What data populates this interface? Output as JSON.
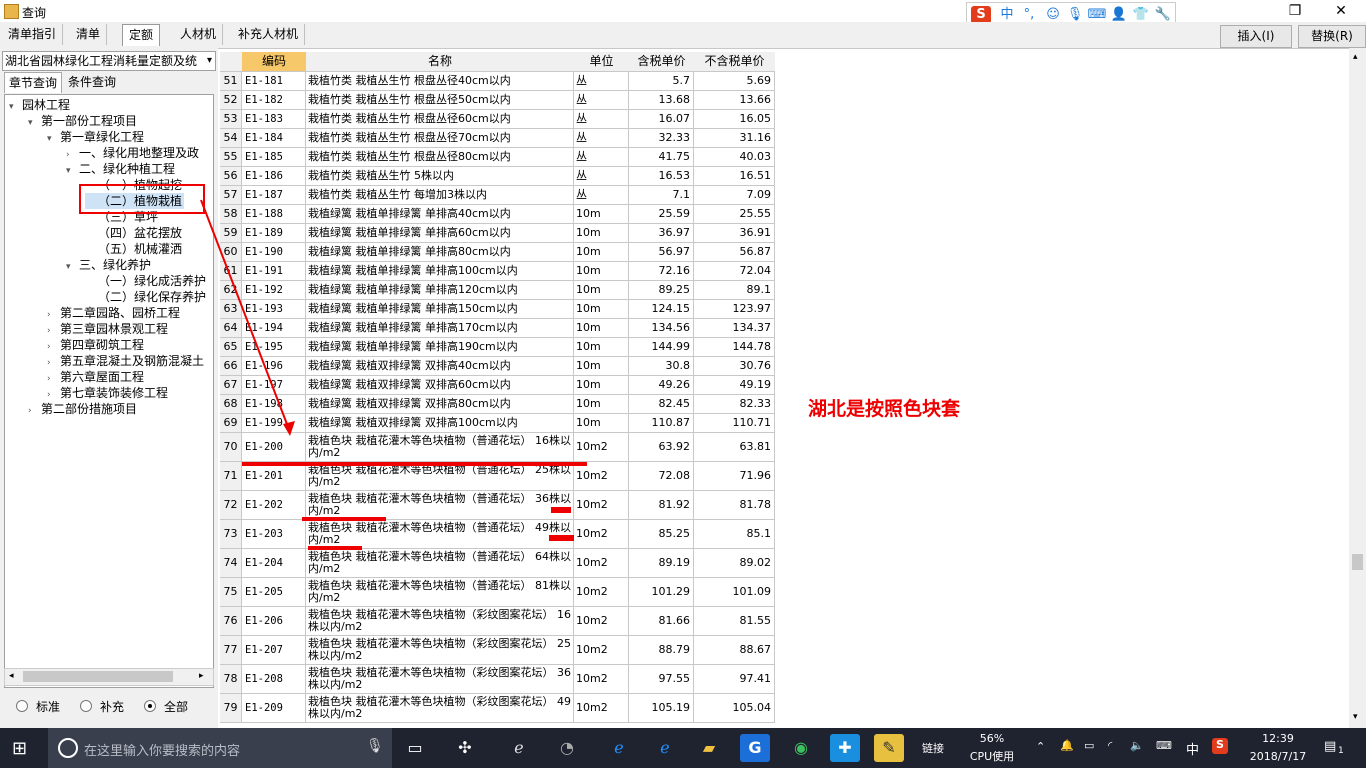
{
  "window": {
    "title": "查询"
  },
  "ime": {
    "brand": "S",
    "mode": "中",
    "punct": "°,"
  },
  "tabs": [
    "清单指引",
    "清单",
    "定额",
    "人材机",
    "补充人材机"
  ],
  "actions": {
    "insert": "插入(I)",
    "replace": "替换(R)"
  },
  "left": {
    "library": "湖北省园林绿化工程消耗量定额及统",
    "subtabs": [
      "章节查询",
      "条件查询"
    ],
    "tree": [
      {
        "label": "园林工程",
        "lvl": 0,
        "tog": "v"
      },
      {
        "label": "第一部份工程项目",
        "lvl": 1,
        "tog": "v"
      },
      {
        "label": "第一章绿化工程",
        "lvl": 2,
        "tog": "v"
      },
      {
        "label": "一、绿化用地整理及政",
        "lvl": 3,
        "tog": ">"
      },
      {
        "label": "二、绿化种植工程",
        "lvl": 3,
        "tog": "v"
      },
      {
        "label": "（一）植物起挖",
        "lvl": 4,
        "tog": ""
      },
      {
        "label": "（二）植物栽植",
        "lvl": 4,
        "tog": "",
        "selected": true
      },
      {
        "label": "（三）草坪",
        "lvl": 4,
        "tog": ""
      },
      {
        "label": "（四）盆花摆放",
        "lvl": 4,
        "tog": ""
      },
      {
        "label": "（五）机械灌洒",
        "lvl": 4,
        "tog": ""
      },
      {
        "label": "三、绿化养护",
        "lvl": 3,
        "tog": "v"
      },
      {
        "label": "（一）绿化成活养护",
        "lvl": 4,
        "tog": ""
      },
      {
        "label": "（二）绿化保存养护",
        "lvl": 4,
        "tog": ""
      },
      {
        "label": "第二章园路、园桥工程",
        "lvl": 2,
        "tog": ">"
      },
      {
        "label": "第三章园林景观工程",
        "lvl": 2,
        "tog": ">"
      },
      {
        "label": "第四章砌筑工程",
        "lvl": 2,
        "tog": ">"
      },
      {
        "label": "第五章混凝土及钢筋混凝土",
        "lvl": 2,
        "tog": ">"
      },
      {
        "label": "第六章屋面工程",
        "lvl": 2,
        "tog": ">"
      },
      {
        "label": "第七章装饰装修工程",
        "lvl": 2,
        "tog": ">"
      },
      {
        "label": "第二部份措施项目",
        "lvl": 1,
        "tog": ">"
      }
    ],
    "radios": [
      {
        "label": "标准",
        "checked": false
      },
      {
        "label": "补充",
        "checked": false
      },
      {
        "label": "全部",
        "checked": true
      }
    ]
  },
  "grid": {
    "headers": [
      "编码",
      "名称",
      "单位",
      "含税单价",
      "不含税单价"
    ],
    "rows": [
      {
        "n": "51",
        "code": "E1-181",
        "name": "栽植竹类 栽植丛生竹 根盘丛径40cm以内",
        "unit": "丛",
        "p1": "5.7",
        "p2": "5.69"
      },
      {
        "n": "52",
        "code": "E1-182",
        "name": "栽植竹类 栽植丛生竹 根盘丛径50cm以内",
        "unit": "丛",
        "p1": "13.68",
        "p2": "13.66"
      },
      {
        "n": "53",
        "code": "E1-183",
        "name": "栽植竹类 栽植丛生竹 根盘丛径60cm以内",
        "unit": "丛",
        "p1": "16.07",
        "p2": "16.05"
      },
      {
        "n": "54",
        "code": "E1-184",
        "name": "栽植竹类 栽植丛生竹 根盘丛径70cm以内",
        "unit": "丛",
        "p1": "32.33",
        "p2": "31.16"
      },
      {
        "n": "55",
        "code": "E1-185",
        "name": "栽植竹类 栽植丛生竹 根盘丛径80cm以内",
        "unit": "丛",
        "p1": "41.75",
        "p2": "40.03"
      },
      {
        "n": "56",
        "code": "E1-186",
        "name": "栽植竹类 栽植丛生竹 5株以内",
        "unit": "丛",
        "p1": "16.53",
        "p2": "16.51"
      },
      {
        "n": "57",
        "code": "E1-187",
        "name": "栽植竹类 栽植丛生竹 每增加3株以内",
        "unit": "丛",
        "p1": "7.1",
        "p2": "7.09"
      },
      {
        "n": "58",
        "code": "E1-188",
        "name": "栽植绿篱 栽植单排绿篱 单排高40cm以内",
        "unit": "10m",
        "p1": "25.59",
        "p2": "25.55"
      },
      {
        "n": "59",
        "code": "E1-189",
        "name": "栽植绿篱 栽植单排绿篱 单排高60cm以内",
        "unit": "10m",
        "p1": "36.97",
        "p2": "36.91"
      },
      {
        "n": "60",
        "code": "E1-190",
        "name": "栽植绿篱 栽植单排绿篱 单排高80cm以内",
        "unit": "10m",
        "p1": "56.97",
        "p2": "56.87"
      },
      {
        "n": "61",
        "code": "E1-191",
        "name": "栽植绿篱 栽植单排绿篱 单排高100cm以内",
        "unit": "10m",
        "p1": "72.16",
        "p2": "72.04"
      },
      {
        "n": "62",
        "code": "E1-192",
        "name": "栽植绿篱 栽植单排绿篱 单排高120cm以内",
        "unit": "10m",
        "p1": "89.25",
        "p2": "89.1"
      },
      {
        "n": "63",
        "code": "E1-193",
        "name": "栽植绿篱 栽植单排绿篱 单排高150cm以内",
        "unit": "10m",
        "p1": "124.15",
        "p2": "123.97"
      },
      {
        "n": "64",
        "code": "E1-194",
        "name": "栽植绿篱 栽植单排绿篱 单排高170cm以内",
        "unit": "10m",
        "p1": "134.56",
        "p2": "134.37"
      },
      {
        "n": "65",
        "code": "E1-195",
        "name": "栽植绿篱 栽植单排绿篱 单排高190cm以内",
        "unit": "10m",
        "p1": "144.99",
        "p2": "144.78"
      },
      {
        "n": "66",
        "code": "E1-196",
        "name": "栽植绿篱 栽植双排绿篱 双排高40cm以内",
        "unit": "10m",
        "p1": "30.8",
        "p2": "30.76"
      },
      {
        "n": "67",
        "code": "E1-197",
        "name": "栽植绿篱 栽植双排绿篱 双排高60cm以内",
        "unit": "10m",
        "p1": "49.26",
        "p2": "49.19"
      },
      {
        "n": "68",
        "code": "E1-198",
        "name": "栽植绿篱 栽植双排绿篱 双排高80cm以内",
        "unit": "10m",
        "p1": "82.45",
        "p2": "82.33"
      },
      {
        "n": "69",
        "code": "E1-199",
        "name": "栽植绿篱 栽植双排绿篱 双排高100cm以内",
        "unit": "10m",
        "p1": "110.87",
        "p2": "110.71"
      },
      {
        "n": "70",
        "code": "E1-200",
        "name": "栽植色块 栽植花灌木等色块植物（普通花坛） 16株以内/m2",
        "unit": "10m2",
        "p1": "63.92",
        "p2": "63.81"
      },
      {
        "n": "71",
        "code": "E1-201",
        "name": "栽植色块 栽植花灌木等色块植物（普通花坛） 25株以内/m2",
        "unit": "10m2",
        "p1": "72.08",
        "p2": "71.96"
      },
      {
        "n": "72",
        "code": "E1-202",
        "name": "栽植色块 栽植花灌木等色块植物（普通花坛） 36株以内/m2",
        "unit": "10m2",
        "p1": "81.92",
        "p2": "81.78"
      },
      {
        "n": "73",
        "code": "E1-203",
        "name": "栽植色块 栽植花灌木等色块植物（普通花坛） 49株以内/m2",
        "unit": "10m2",
        "p1": "85.25",
        "p2": "85.1"
      },
      {
        "n": "74",
        "code": "E1-204",
        "name": "栽植色块 栽植花灌木等色块植物（普通花坛） 64株以内/m2",
        "unit": "10m2",
        "p1": "89.19",
        "p2": "89.02"
      },
      {
        "n": "75",
        "code": "E1-205",
        "name": "栽植色块 栽植花灌木等色块植物（普通花坛） 81株以内/m2",
        "unit": "10m2",
        "p1": "101.29",
        "p2": "101.09"
      },
      {
        "n": "76",
        "code": "E1-206",
        "name": "栽植色块 栽植花灌木等色块植物（彩纹图案花坛） 16株以内/m2",
        "unit": "10m2",
        "p1": "81.66",
        "p2": "81.55"
      },
      {
        "n": "77",
        "code": "E1-207",
        "name": "栽植色块 栽植花灌木等色块植物（彩纹图案花坛） 25株以内/m2",
        "unit": "10m2",
        "p1": "88.79",
        "p2": "88.67"
      },
      {
        "n": "78",
        "code": "E1-208",
        "name": "栽植色块 栽植花灌木等色块植物（彩纹图案花坛） 36株以内/m2",
        "unit": "10m2",
        "p1": "97.55",
        "p2": "97.41"
      },
      {
        "n": "79",
        "code": "E1-209",
        "name": "栽植色块 栽植花灌木等色块植物（彩纹图案花坛） 49株以内/m2",
        "unit": "10m2",
        "p1": "105.19",
        "p2": "105.04"
      }
    ]
  },
  "annotation": {
    "note": "湖北是按照色块套"
  },
  "taskbar": {
    "search_placeholder": "在这里输入你要搜索的内容",
    "link": "链接",
    "cpu_pct": "56%",
    "cpu_label": "CPU使用",
    "lang": "中",
    "time": "12:39",
    "date": "2018/7/17",
    "notif": "1"
  }
}
